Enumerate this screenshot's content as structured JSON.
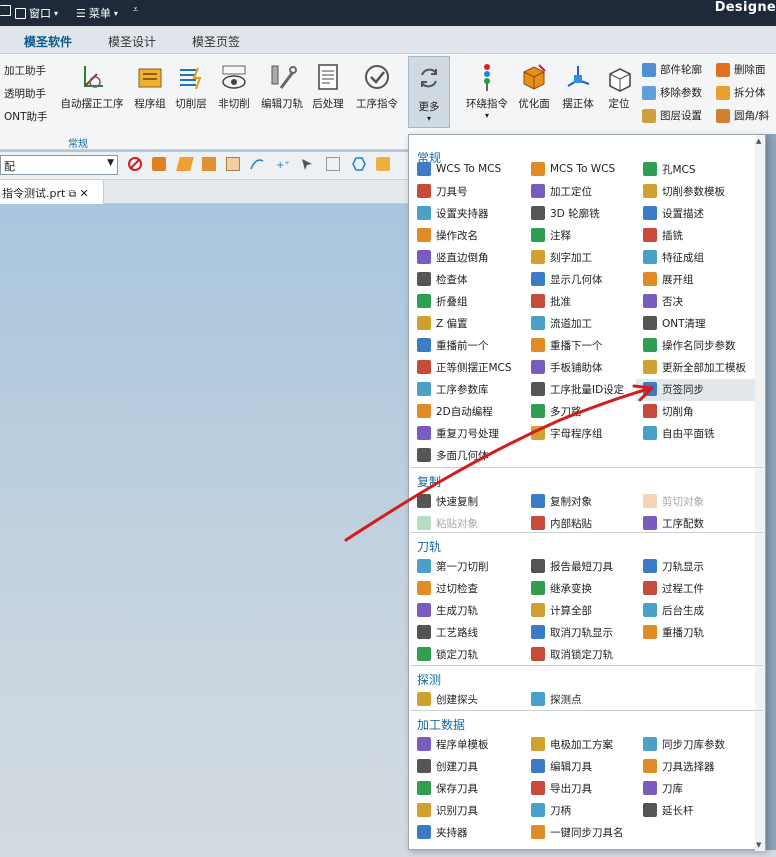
{
  "titlebar": {
    "window_menu": "窗口",
    "menu_label": "菜单",
    "brand": "Designe"
  },
  "tabs": [
    {
      "label": "模圣软件"
    },
    {
      "label": "模圣设计"
    },
    {
      "label": "模圣页签"
    }
  ],
  "ribbon": {
    "left_small": [
      "加工助手",
      "透明助手",
      "ONT助手"
    ],
    "buttons": [
      {
        "label": "自动摆正工序"
      },
      {
        "label": "程序组"
      },
      {
        "label": "切削层"
      },
      {
        "label": "非切削"
      },
      {
        "label": "编辑刀轨"
      },
      {
        "label": "后处理"
      },
      {
        "label": "工序指令"
      },
      {
        "label": "更多"
      },
      {
        "label": "环绕指令"
      },
      {
        "label": "优化面"
      },
      {
        "label": "摆正体"
      },
      {
        "label": "定位"
      }
    ],
    "right_small": [
      "部件轮廓",
      "移除参数",
      "图层设置",
      "删除面",
      "拆分体",
      "圆角/斜"
    ],
    "group_label": "常规"
  },
  "toolbar": {
    "combo_value": "配"
  },
  "file_tab": {
    "name": "指令测试.prt"
  },
  "menu": {
    "sections": [
      {
        "title": "常规",
        "items": [
          "WCS To MCS",
          "MCS To WCS",
          "孔MCS",
          "刀具号",
          "加工定位",
          "切削参数模板",
          "设置夹持器",
          "3D 轮廓铣",
          "设置描述",
          "操作改名",
          "注释",
          "插铣",
          "竖直边倒角",
          "刻字加工",
          "特征成组",
          "检查体",
          "显示几何体",
          "展开组",
          "折叠组",
          "批准",
          "否决",
          "Z 偏置",
          "流道加工",
          "ONT清理",
          "重播前一个",
          "重播下一个",
          "操作名同步参数",
          "正等侧摆正MCS",
          "手板铺助体",
          "更新全部加工模板",
          "工序参数库",
          "工序批量ID设定",
          "页签同步",
          "2D自动编程",
          "多刀路",
          "切削角",
          "重复刀号处理",
          "字母程序组",
          "自由平面铣",
          "多面几何体"
        ]
      },
      {
        "title": "复制",
        "items": [
          "快速复制",
          "复制对象",
          "剪切对象",
          "粘贴对象",
          "内部粘贴",
          "工序配数"
        ]
      },
      {
        "title": "刀轨",
        "items": [
          "第一刀切削",
          "报告最短刀具",
          "刀轨显示",
          "过切检查",
          "继承变换",
          "过程工件",
          "生成刀轨",
          "计算全部",
          "后台生成",
          "工艺路线",
          "取消刀轨显示",
          "重播刀轨",
          "锁定刀轨",
          "取消锁定刀轨"
        ]
      },
      {
        "title": "探测",
        "items": [
          "创建探头",
          "探测点"
        ]
      },
      {
        "title": "加工数据",
        "items": [
          "程序单模板",
          "电极加工方案",
          "同步刀库参数",
          "创建刀具",
          "编辑刀具",
          "刀具选择器",
          "保存刀具",
          "导出刀具",
          "刀库",
          "识别刀具",
          "刀柄",
          "延长杆",
          "夹持器",
          "一键同步刀具名"
        ]
      }
    ],
    "disabled": [
      "剪切对象",
      "粘贴对象"
    ],
    "highlighted": "页签同步"
  },
  "colors": {
    "accent": "#1a7abf",
    "section": "#1a6aa0",
    "annotation_arrow": "#d41c1c"
  }
}
